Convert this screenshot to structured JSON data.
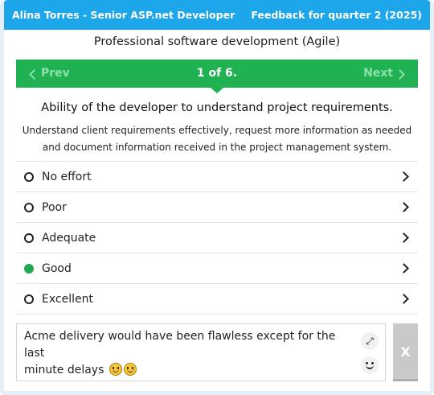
{
  "header": {
    "employee": "Alina Torres - Senior ASP.net Developer",
    "feedback_period": "Feedback for quarter 2 (2025)"
  },
  "section_title": "Professional software development (Agile)",
  "nav": {
    "prev_label": "Prev",
    "next_label": "Next",
    "counter": "1 of 6."
  },
  "question": {
    "title": "Ability of the developer to understand project requirements.",
    "description_line1": "Understand client requirements effectively, request more information as needed",
    "description_line2": "and document information received in the project management system."
  },
  "options": [
    {
      "label": "No effort",
      "selected": false
    },
    {
      "label": "Poor",
      "selected": false
    },
    {
      "label": "Adequate",
      "selected": false
    },
    {
      "label": "Good",
      "selected": true
    },
    {
      "label": "Excellent",
      "selected": false
    }
  ],
  "comment": {
    "text_line1": "Acme delivery would have been flawless except for the last",
    "text_line2": "minute delays",
    "emojis": [
      "smiley-emoji",
      "smiley-emoji"
    ]
  },
  "clear_label": "X",
  "icons": {
    "prev": "chevron-left-icon",
    "next": "chevron-right-icon",
    "option_arrow": "chevron-right-icon",
    "expand": "expand-icon",
    "emoji_picker": "smiley-icon"
  },
  "colors": {
    "header_bg": "#1da7ea",
    "nav_bg": "#1fb152",
    "selected_radio": "#22a84e",
    "clear_button": "#c9c9c9"
  }
}
